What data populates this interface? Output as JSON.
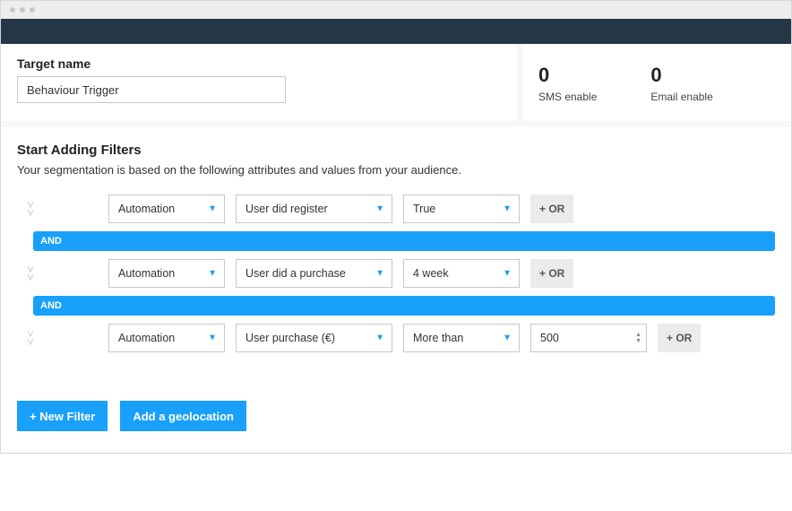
{
  "colors": {
    "accent": "#18a0fb",
    "header": "#253746"
  },
  "header": {
    "target_label": "Target name",
    "target_value": "Behaviour Trigger",
    "stats": [
      {
        "value": "0",
        "label": "SMS enable"
      },
      {
        "value": "0",
        "label": "Email enable"
      }
    ]
  },
  "filters": {
    "heading": "Start Adding Filters",
    "subheading": "Your segmentation is based on the following attributes and values from your audience.",
    "and_label": "AND",
    "or_label": "+ OR",
    "rows": [
      {
        "category": "Automation",
        "attribute": "User did register",
        "operator": null,
        "value_select": "True",
        "value_number": null
      },
      {
        "category": "Automation",
        "attribute": "User did a purchase",
        "operator": null,
        "value_select": "4 week",
        "value_number": null
      },
      {
        "category": "Automation",
        "attribute": "User purchase (€)",
        "operator": "More than",
        "value_select": null,
        "value_number": "500"
      }
    ]
  },
  "actions": {
    "new_filter": "+ New Filter",
    "add_geolocation": "Add a geolocation"
  }
}
